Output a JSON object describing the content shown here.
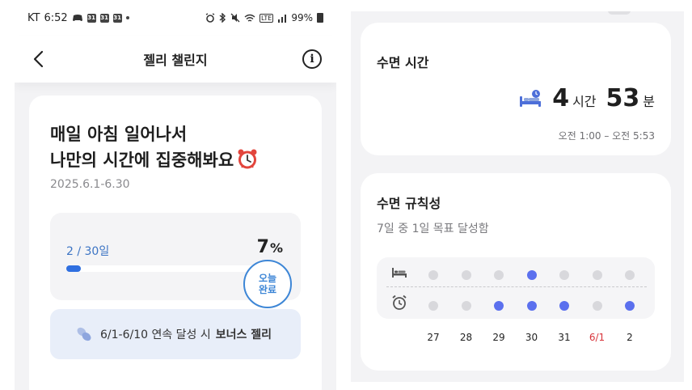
{
  "status": {
    "carrier": "KT",
    "time": "6:52",
    "battery": "99%",
    "cal_icon_text": "31",
    "signal_text": "LTE"
  },
  "header": {
    "title": "젤리 챌린지",
    "info_glyph": "i"
  },
  "challenge": {
    "headline_line1": "매일 아침 일어나서",
    "headline_line2": "나만의 시간에 집중해봐요",
    "date_range": "2025.6.1-6.30",
    "progress_count": "2 / 30일",
    "progress_percent_value": "7",
    "progress_percent_symbol": "%",
    "progress_fraction": 0.07,
    "today_badge_line1": "오늘",
    "today_badge_line2": "완료",
    "bonus_text": "6/1-6/10 연속 달성 시",
    "bonus_reward": "보너스 젤리"
  },
  "sleep_time": {
    "title": "수면 시간",
    "hours": "4",
    "hours_unit": "시간",
    "minutes": "53",
    "minutes_unit": "분",
    "range": "오전 1:00 – 오전 5:53"
  },
  "sleep_regularity": {
    "title": "수면 규칙성",
    "subtitle": "7일 중 1일 목표 달성함",
    "days": [
      {
        "label": "27",
        "red": false,
        "bed": false,
        "wake": false
      },
      {
        "label": "28",
        "red": false,
        "bed": false,
        "wake": false
      },
      {
        "label": "29",
        "red": false,
        "bed": false,
        "wake": true
      },
      {
        "label": "30",
        "red": false,
        "bed": true,
        "wake": true
      },
      {
        "label": "31",
        "red": false,
        "bed": false,
        "wake": true
      },
      {
        "label": "6/1",
        "red": true,
        "bed": false,
        "wake": false
      },
      {
        "label": "2",
        "red": false,
        "bed": false,
        "wake": true
      }
    ]
  },
  "colors": {
    "accent_blue": "#2f6fe0",
    "dot_on": "#5b70ee",
    "dot_off": "#d8d8dc",
    "holiday_red": "#d8333a"
  },
  "icons": {
    "back": "chevron-left-icon",
    "info": "info-icon",
    "alarm": "alarm-clock-icon",
    "jelly": "jelly-icon",
    "bed": "bed-icon",
    "wake": "alarm-icon"
  }
}
